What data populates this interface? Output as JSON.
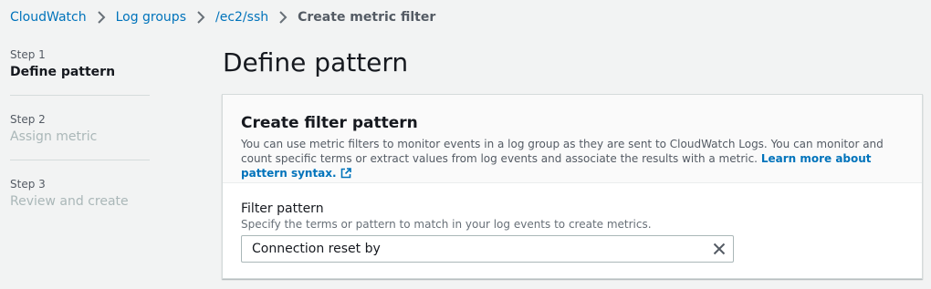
{
  "breadcrumb": {
    "items": [
      "CloudWatch",
      "Log groups",
      "/ec2/ssh"
    ],
    "current": "Create metric filter"
  },
  "steps": [
    {
      "number": "Step 1",
      "title": "Define pattern",
      "active": true
    },
    {
      "number": "Step 2",
      "title": "Assign metric",
      "active": false
    },
    {
      "number": "Step 3",
      "title": "Review and create",
      "active": false
    }
  ],
  "page": {
    "title": "Define pattern"
  },
  "panel": {
    "title": "Create filter pattern",
    "description": "You can use metric filters to monitor events in a log group as they are sent to CloudWatch Logs. You can monitor and count specific terms or extract values from log events and associate the results with a metric.",
    "learn_more": "Learn more about pattern syntax.",
    "filter": {
      "label": "Filter pattern",
      "description": "Specify the terms or pattern to match in your log events to create metrics.",
      "value": "Connection reset by"
    }
  },
  "icons": {
    "separator": "chevron-right-icon",
    "external": "external-link-icon",
    "clear": "close-icon"
  },
  "colors": {
    "link": "#0073bb",
    "background": "#f2f3f3",
    "text": "#16191f",
    "muted": "#545b64",
    "disabled": "#aab7b8"
  }
}
